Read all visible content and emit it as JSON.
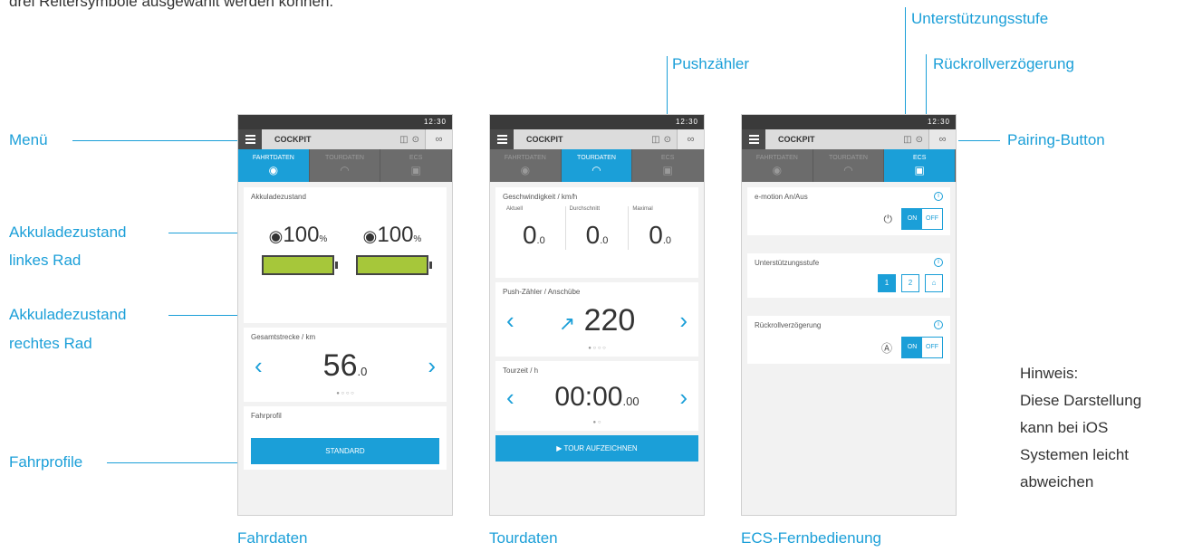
{
  "top_caption": "drei Reitersymbole ausgewählt werden können.",
  "callouts": {
    "menu": "Menü",
    "akku_links_1": "Akkuladezustand",
    "akku_links_2": "linkes Rad",
    "akku_rechts_1": "Akkuladezustand",
    "akku_rechts_2": "rechtes Rad",
    "fahrprofile": "Fahrprofile",
    "pushzaehler": "Pushzähler",
    "unterstuetzung": "Unterstützungsstufe",
    "rueckroll": "Rückrollverzögerung",
    "pairing": "Pairing-Button"
  },
  "captions": {
    "fahrdaten": "Fahrdaten",
    "tourdaten": "Tourdaten",
    "ecs": "ECS-Fernbedienung"
  },
  "hint": [
    "Hinweis:",
    "Diese Darstellung",
    "kann bei iOS",
    "Systemen leicht",
    "abweichen"
  ],
  "app": {
    "status_time": "12:30",
    "title": "COCKPIT",
    "tabs": [
      "FAHRTDATEN",
      "TOURDATEN",
      "ECS"
    ],
    "icons": {
      "menu": "hamburger-icon",
      "pairing": "link-icon",
      "level": "box-icon",
      "rollback": "lock-icon"
    }
  },
  "screen1": {
    "akku_label": "Akkuladezustand",
    "left_value": "100",
    "right_value": "100",
    "unit": "%",
    "left_level": 1.0,
    "right_level": 1.0,
    "distance_label": "Gesamtstrecke / km",
    "distance_int": "56",
    "distance_dec": ".0",
    "profile_label": "Fahrprofil",
    "profile_button": "STANDARD"
  },
  "screen2": {
    "speed_label": "Geschwindigkeit / km/h",
    "col_aktuell": "Aktuell",
    "col_durchschnitt": "Durchschnitt",
    "col_maximal": "Maximal",
    "v_aktuell": "0",
    "v_durchschnitt": "0",
    "v_maximal": "0",
    "v_dec": ".0",
    "push_label": "Push-Zähler / Anschübe",
    "push_value": "220",
    "tour_label": "Tourzeit / h",
    "tour_main": "00:00",
    "tour_dec": ".00",
    "tour_button": "TOUR AUFZEICHNEN"
  },
  "screen3": {
    "emotion_label": "e-motion An/Aus",
    "on": "ON",
    "off": "OFF",
    "level_label": "Unterstützungsstufe",
    "level_1": "1",
    "level_2": "2",
    "rollback_label": "Rückrollverzögerung"
  },
  "colors": {
    "accent": "#1b9fd8",
    "battery": "#a6c73a"
  }
}
